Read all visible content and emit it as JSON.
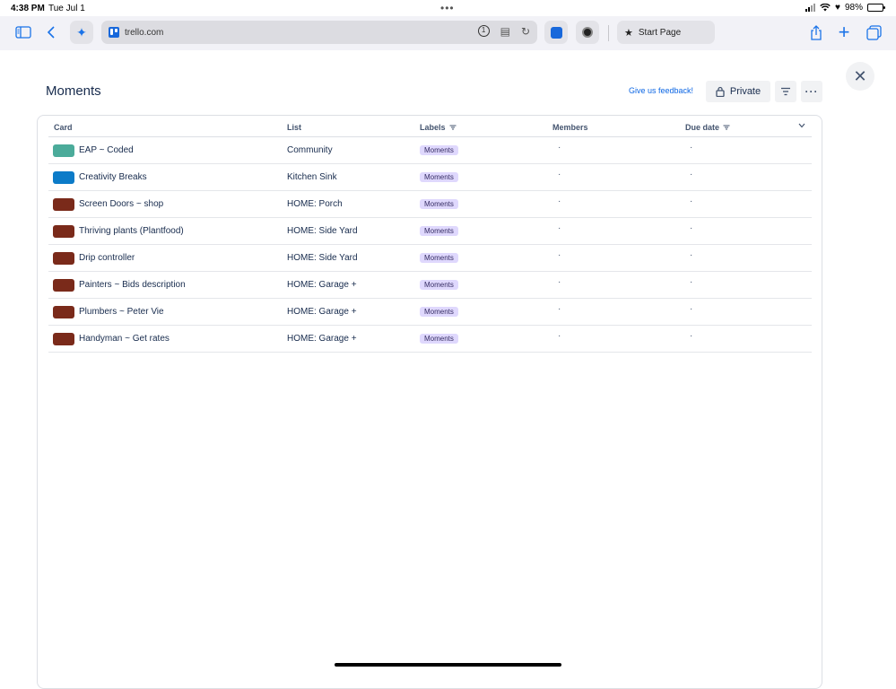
{
  "status_bar": {
    "time": "4:38 PM",
    "date": "Tue Jul 1",
    "battery": "98%",
    "battery_level": 0.98
  },
  "browser": {
    "url": "trello.com",
    "start_page_label": "Start Page"
  },
  "page": {
    "title": "Moments",
    "feedback_link": "Give us feedback!",
    "visibility_button": "Private"
  },
  "table": {
    "columns": {
      "card": "Card",
      "list": "List",
      "labels": "Labels",
      "members": "Members",
      "due_date": "Due date"
    },
    "rows": [
      {
        "color": "#4bab9a",
        "card": "EAP ~ Coded",
        "list": "Community",
        "label": "Moments",
        "members": "·",
        "due": "·"
      },
      {
        "color": "#0c7bc8",
        "card": "Creativity Breaks",
        "list": "Kitchen Sink",
        "label": "Moments",
        "members": "·",
        "due": "·"
      },
      {
        "color": "#7a2a1a",
        "card": "Screen Doors ~ shop",
        "list": "HOME: Porch",
        "label": "Moments",
        "members": "·",
        "due": "·"
      },
      {
        "color": "#7a2a1a",
        "card": "Thriving plants (Plantfood)",
        "list": "HOME: Side Yard",
        "label": "Moments",
        "members": "·",
        "due": "·"
      },
      {
        "color": "#7a2a1a",
        "card": "Drip controller",
        "list": "HOME: Side Yard",
        "label": "Moments",
        "members": "·",
        "due": "·"
      },
      {
        "color": "#7a2a1a",
        "card": "Painters ~ Bids description",
        "list": "HOME: Garage +",
        "label": "Moments",
        "members": "·",
        "due": "·"
      },
      {
        "color": "#7a2a1a",
        "card": "Plumbers ~ Peter Vie",
        "list": "HOME: Garage +",
        "label": "Moments",
        "members": "·",
        "due": "·"
      },
      {
        "color": "#7a2a1a",
        "card": "Handyman ~ Get rates",
        "list": "HOME: Garage +",
        "label": "Moments",
        "members": "·",
        "due": "·"
      }
    ]
  }
}
